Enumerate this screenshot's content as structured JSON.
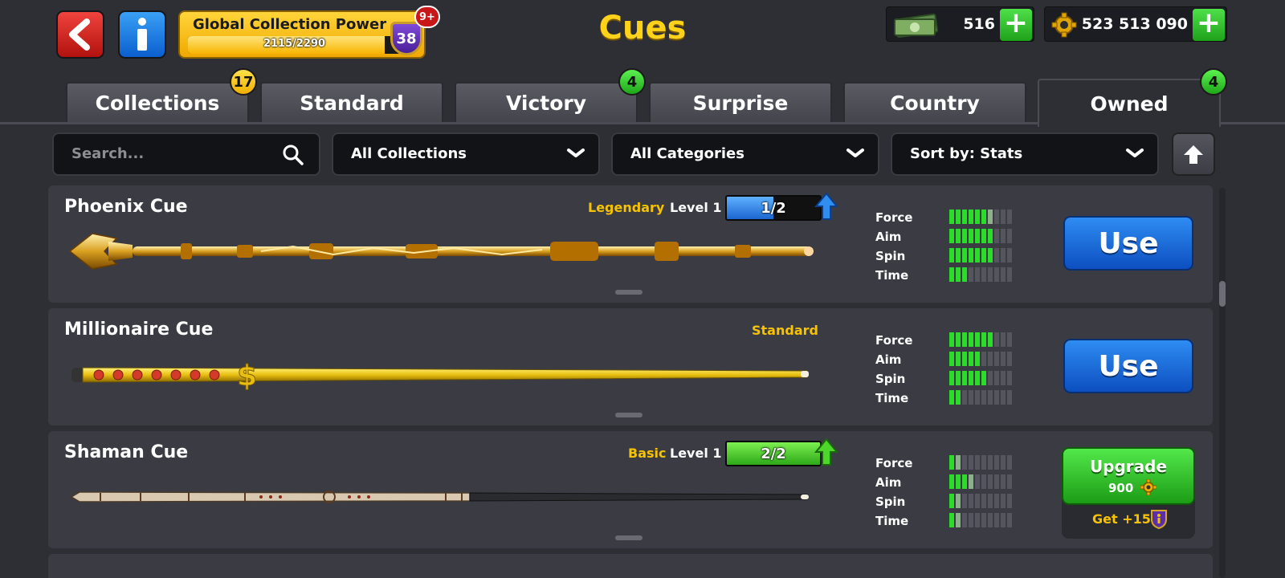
{
  "header": {
    "title": "Cues",
    "collection_power": {
      "label": "Global Collection Power",
      "progress_text": "2115/2290",
      "progress_fraction": 0.924,
      "level": "38",
      "notification": "9+"
    },
    "cash": {
      "value": "516",
      "icon": "cash-icon"
    },
    "coins": {
      "value": "523 513 090",
      "icon": "coin-icon"
    }
  },
  "tabs": [
    {
      "label": "Collections",
      "badge": "17",
      "badge_color": "#f0b000"
    },
    {
      "label": "Standard"
    },
    {
      "label": "Victory",
      "badge": "4",
      "badge_color": "#1ea81a"
    },
    {
      "label": "Surprise"
    },
    {
      "label": "Country"
    },
    {
      "label": "Owned",
      "badge": "4",
      "badge_color": "#1ea81a",
      "active": true
    }
  ],
  "filters": {
    "search_placeholder": "Search...",
    "collections": "All Collections",
    "categories": "All Categories",
    "sort": "Sort by: Stats"
  },
  "stat_labels": [
    "Force",
    "Aim",
    "Spin",
    "Time"
  ],
  "cues": [
    {
      "name": "Phoenix Cue",
      "rarity": "Legendary",
      "level_label": "Level 1",
      "level_progress": "1/2",
      "level_fraction": 0.5,
      "stats": [
        6.5,
        7,
        7,
        3
      ],
      "action": "Use"
    },
    {
      "name": "Millionaire Cue",
      "rarity": "Standard",
      "stats": [
        7,
        5,
        6,
        2
      ],
      "action": "Use"
    },
    {
      "name": "Shaman Cue",
      "rarity": "Basic",
      "level_label": "Level 1",
      "level_progress": "2/2",
      "level_fraction": 1.0,
      "stats": [
        1.5,
        3.5,
        1.5,
        1.5
      ],
      "action": "Upgrade",
      "upgrade_cost": "900",
      "reward_label": "Get +15"
    }
  ],
  "colors": {
    "accent_yellow": "#f7c300",
    "use_blue": "#0d4fc0",
    "upgrade_green": "#1c9c16",
    "stat_green": "#2cdc2a"
  }
}
